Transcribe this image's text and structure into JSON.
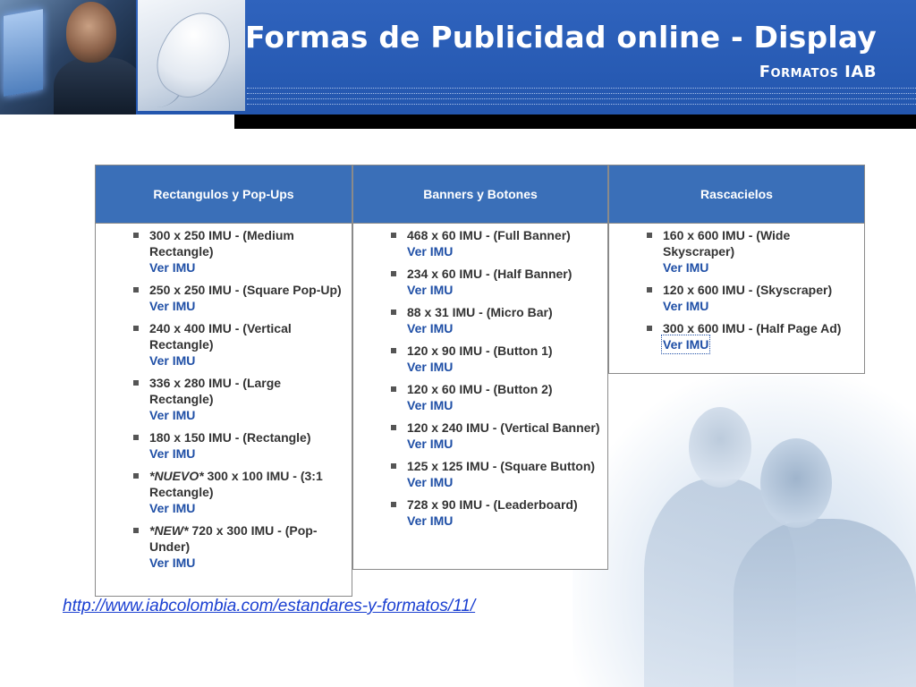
{
  "header": {
    "title": "Formas de Publicidad online - Display",
    "subtitle": "Formatos IAB"
  },
  "columns": [
    {
      "heading": "Rectangulos y Pop-Ups",
      "items": [
        {
          "text": "300 x 250 IMU - (Medium Rectangle)",
          "link": "Ver IMU"
        },
        {
          "text": "250 x 250 IMU - (Square Pop-Up)",
          "link": "Ver IMU"
        },
        {
          "text": "240 x 400 IMU - (Vertical Rectangle)",
          "link": "Ver IMU"
        },
        {
          "text": "336 x 280 IMU - (Large Rectangle)",
          "link": "Ver IMU"
        },
        {
          "text": "180 x 150 IMU - (Rectangle)",
          "link": "Ver IMU"
        },
        {
          "tag": "*NUEVO*",
          "text": " 300 x 100 IMU - (3:1 Rectangle)",
          "link": "Ver IMU"
        },
        {
          "tag": "*NEW*",
          "text": " 720 x 300 IMU - (Pop-Under)",
          "link": "Ver IMU"
        }
      ]
    },
    {
      "heading": "Banners y Botones",
      "items": [
        {
          "text": "468 x 60 IMU - (Full Banner)",
          "link": "Ver IMU"
        },
        {
          "text": "234 x 60 IMU - (Half Banner)",
          "link": "Ver IMU"
        },
        {
          "text": "88 x 31 IMU - (Micro Bar)",
          "link": "Ver IMU"
        },
        {
          "text": "120 x 90 IMU - (Button 1)",
          "link": "Ver IMU"
        },
        {
          "text": "120 x 60 IMU - (Button 2)",
          "link": "Ver IMU"
        },
        {
          "text": "120 x 240 IMU - (Vertical Banner)",
          "link": "Ver IMU"
        },
        {
          "text": "125 x 125 IMU - (Square Button)",
          "link": "Ver IMU"
        },
        {
          "text": "728 x 90 IMU - (Leaderboard)",
          "link": "Ver IMU"
        }
      ]
    },
    {
      "heading": "Rascacielos",
      "items": [
        {
          "text": "160 x 600 IMU - (Wide Skyscraper)",
          "link": "Ver IMU"
        },
        {
          "text": "120 x 600 IMU - (Skyscraper)",
          "link": "Ver IMU"
        },
        {
          "text": "300 x 600 IMU - (Half Page Ad)",
          "link": "Ver IMU",
          "focused": true
        }
      ]
    }
  ],
  "source_url": "http://www.iabcolombia.com/estandares-y-formatos/11/"
}
